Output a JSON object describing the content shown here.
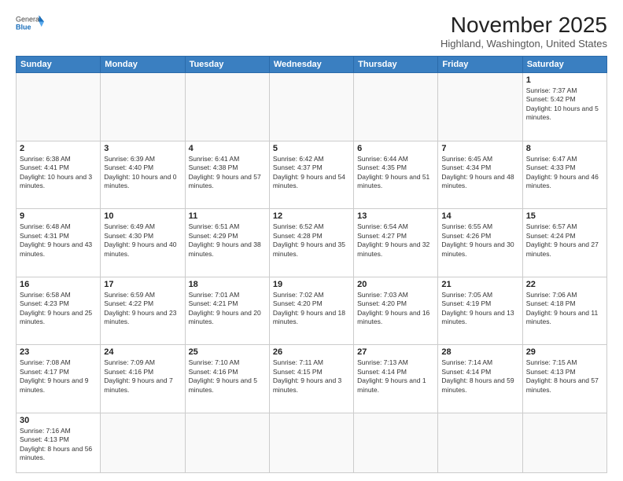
{
  "header": {
    "logo": {
      "general": "General",
      "blue": "Blue"
    },
    "title": "November 2025",
    "location": "Highland, Washington, United States"
  },
  "weekdays": [
    "Sunday",
    "Monday",
    "Tuesday",
    "Wednesday",
    "Thursday",
    "Friday",
    "Saturday"
  ],
  "weeks": [
    [
      {
        "day": "",
        "info": ""
      },
      {
        "day": "",
        "info": ""
      },
      {
        "day": "",
        "info": ""
      },
      {
        "day": "",
        "info": ""
      },
      {
        "day": "",
        "info": ""
      },
      {
        "day": "",
        "info": ""
      },
      {
        "day": "1",
        "info": "Sunrise: 7:37 AM\nSunset: 5:42 PM\nDaylight: 10 hours and 5 minutes."
      }
    ],
    [
      {
        "day": "2",
        "info": "Sunrise: 6:38 AM\nSunset: 4:41 PM\nDaylight: 10 hours and 3 minutes."
      },
      {
        "day": "3",
        "info": "Sunrise: 6:39 AM\nSunset: 4:40 PM\nDaylight: 10 hours and 0 minutes."
      },
      {
        "day": "4",
        "info": "Sunrise: 6:41 AM\nSunset: 4:38 PM\nDaylight: 9 hours and 57 minutes."
      },
      {
        "day": "5",
        "info": "Sunrise: 6:42 AM\nSunset: 4:37 PM\nDaylight: 9 hours and 54 minutes."
      },
      {
        "day": "6",
        "info": "Sunrise: 6:44 AM\nSunset: 4:35 PM\nDaylight: 9 hours and 51 minutes."
      },
      {
        "day": "7",
        "info": "Sunrise: 6:45 AM\nSunset: 4:34 PM\nDaylight: 9 hours and 48 minutes."
      },
      {
        "day": "8",
        "info": "Sunrise: 6:47 AM\nSunset: 4:33 PM\nDaylight: 9 hours and 46 minutes."
      }
    ],
    [
      {
        "day": "9",
        "info": "Sunrise: 6:48 AM\nSunset: 4:31 PM\nDaylight: 9 hours and 43 minutes."
      },
      {
        "day": "10",
        "info": "Sunrise: 6:49 AM\nSunset: 4:30 PM\nDaylight: 9 hours and 40 minutes."
      },
      {
        "day": "11",
        "info": "Sunrise: 6:51 AM\nSunset: 4:29 PM\nDaylight: 9 hours and 38 minutes."
      },
      {
        "day": "12",
        "info": "Sunrise: 6:52 AM\nSunset: 4:28 PM\nDaylight: 9 hours and 35 minutes."
      },
      {
        "day": "13",
        "info": "Sunrise: 6:54 AM\nSunset: 4:27 PM\nDaylight: 9 hours and 32 minutes."
      },
      {
        "day": "14",
        "info": "Sunrise: 6:55 AM\nSunset: 4:26 PM\nDaylight: 9 hours and 30 minutes."
      },
      {
        "day": "15",
        "info": "Sunrise: 6:57 AM\nSunset: 4:24 PM\nDaylight: 9 hours and 27 minutes."
      }
    ],
    [
      {
        "day": "16",
        "info": "Sunrise: 6:58 AM\nSunset: 4:23 PM\nDaylight: 9 hours and 25 minutes."
      },
      {
        "day": "17",
        "info": "Sunrise: 6:59 AM\nSunset: 4:22 PM\nDaylight: 9 hours and 23 minutes."
      },
      {
        "day": "18",
        "info": "Sunrise: 7:01 AM\nSunset: 4:21 PM\nDaylight: 9 hours and 20 minutes."
      },
      {
        "day": "19",
        "info": "Sunrise: 7:02 AM\nSunset: 4:20 PM\nDaylight: 9 hours and 18 minutes."
      },
      {
        "day": "20",
        "info": "Sunrise: 7:03 AM\nSunset: 4:20 PM\nDaylight: 9 hours and 16 minutes."
      },
      {
        "day": "21",
        "info": "Sunrise: 7:05 AM\nSunset: 4:19 PM\nDaylight: 9 hours and 13 minutes."
      },
      {
        "day": "22",
        "info": "Sunrise: 7:06 AM\nSunset: 4:18 PM\nDaylight: 9 hours and 11 minutes."
      }
    ],
    [
      {
        "day": "23",
        "info": "Sunrise: 7:08 AM\nSunset: 4:17 PM\nDaylight: 9 hours and 9 minutes."
      },
      {
        "day": "24",
        "info": "Sunrise: 7:09 AM\nSunset: 4:16 PM\nDaylight: 9 hours and 7 minutes."
      },
      {
        "day": "25",
        "info": "Sunrise: 7:10 AM\nSunset: 4:16 PM\nDaylight: 9 hours and 5 minutes."
      },
      {
        "day": "26",
        "info": "Sunrise: 7:11 AM\nSunset: 4:15 PM\nDaylight: 9 hours and 3 minutes."
      },
      {
        "day": "27",
        "info": "Sunrise: 7:13 AM\nSunset: 4:14 PM\nDaylight: 9 hours and 1 minute."
      },
      {
        "day": "28",
        "info": "Sunrise: 7:14 AM\nSunset: 4:14 PM\nDaylight: 8 hours and 59 minutes."
      },
      {
        "day": "29",
        "info": "Sunrise: 7:15 AM\nSunset: 4:13 PM\nDaylight: 8 hours and 57 minutes."
      }
    ],
    [
      {
        "day": "30",
        "info": "Sunrise: 7:16 AM\nSunset: 4:13 PM\nDaylight: 8 hours and 56 minutes."
      },
      {
        "day": "",
        "info": ""
      },
      {
        "day": "",
        "info": ""
      },
      {
        "day": "",
        "info": ""
      },
      {
        "day": "",
        "info": ""
      },
      {
        "day": "",
        "info": ""
      },
      {
        "day": "",
        "info": ""
      }
    ]
  ]
}
